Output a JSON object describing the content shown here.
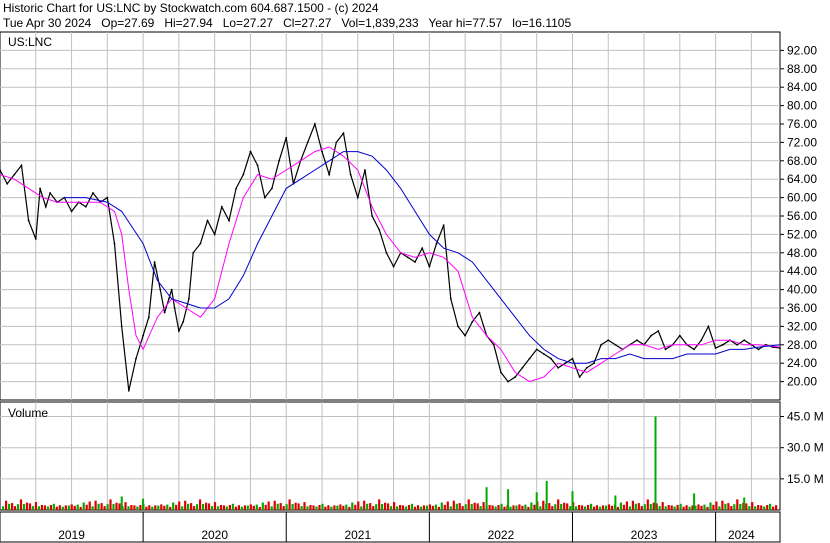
{
  "header": {
    "line1": "Historic Chart for US:LNC by Stockwatch.com 604.687.1500 - (c) 2024",
    "line2": "Tue Apr 30 2024   Op=27.69   Hi=27.94   Lo=27.27   Cl=27.27   Vol=1,839,233   Year hi=77.57   lo=16.1105"
  },
  "chart_data": [
    {
      "type": "line",
      "title": "US:LNC",
      "ylim": [
        16,
        96
      ],
      "yticks": [
        20,
        24,
        28,
        32,
        36,
        40,
        44,
        48,
        52,
        56,
        60,
        64,
        68,
        72,
        76,
        80,
        84,
        88,
        92
      ],
      "ytick_labels": [
        "20.00",
        "24.00",
        "28.00",
        "32.00",
        "36.00",
        "40.00",
        "44.00",
        "48.00",
        "52.00",
        "56.00",
        "60.00",
        "64.00",
        "68.00",
        "72.00",
        "76.00",
        "80.00",
        "84.00",
        "88.00",
        "92.00"
      ],
      "xlim": [
        2019.0,
        2024.45
      ],
      "xticks": [
        2019.5,
        2020.5,
        2021.5,
        2022.5,
        2023.5,
        2024.18
      ],
      "xtick_labels": [
        "2019",
        "2020",
        "2021",
        "2022",
        "2023",
        "2024"
      ],
      "grid": true,
      "colors": {
        "price": "#000000",
        "ma_short": "#ff00ff",
        "ma_long": "#0000cc",
        "grid": "#c0c0c0"
      },
      "series": [
        {
          "role": "price",
          "x": [
            2019.0,
            2019.05,
            2019.1,
            2019.15,
            2019.2,
            2019.25,
            2019.28,
            2019.32,
            2019.35,
            2019.4,
            2019.45,
            2019.5,
            2019.55,
            2019.6,
            2019.65,
            2019.7,
            2019.75,
            2019.8,
            2019.85,
            2019.9,
            2019.95,
            2020.0,
            2020.04,
            2020.08,
            2020.12,
            2020.15,
            2020.18,
            2020.2,
            2020.22,
            2020.25,
            2020.28,
            2020.32,
            2020.35,
            2020.4,
            2020.45,
            2020.5,
            2020.55,
            2020.6,
            2020.65,
            2020.7,
            2020.75,
            2020.8,
            2020.85,
            2020.9,
            2020.95,
            2021.0,
            2021.05,
            2021.1,
            2021.15,
            2021.2,
            2021.25,
            2021.3,
            2021.35,
            2021.4,
            2021.45,
            2021.5,
            2021.55,
            2021.6,
            2021.65,
            2021.7,
            2021.75,
            2021.8,
            2021.85,
            2021.9,
            2021.95,
            2022.0,
            2022.05,
            2022.1,
            2022.15,
            2022.2,
            2022.25,
            2022.3,
            2022.35,
            2022.4,
            2022.45,
            2022.5,
            2022.55,
            2022.6,
            2022.65,
            2022.7,
            2022.75,
            2022.8,
            2022.85,
            2022.9,
            2022.95,
            2023.0,
            2023.05,
            2023.1,
            2023.15,
            2023.2,
            2023.25,
            2023.3,
            2023.35,
            2023.4,
            2023.45,
            2023.5,
            2023.55,
            2023.6,
            2023.65,
            2023.7,
            2023.75,
            2023.8,
            2023.85,
            2023.9,
            2023.95,
            2024.0,
            2024.05,
            2024.1,
            2024.15,
            2024.2,
            2024.25,
            2024.3,
            2024.35,
            2024.4,
            2024.45
          ],
          "values": [
            66,
            63,
            65,
            67,
            55,
            51,
            62,
            58,
            61,
            59,
            60,
            57,
            59,
            58,
            61,
            59,
            60,
            50,
            32,
            18,
            25,
            30,
            34,
            46,
            40,
            35,
            38,
            40,
            36,
            31,
            33,
            38,
            48,
            50,
            55,
            52,
            58,
            55,
            62,
            65,
            70,
            67,
            60,
            62,
            68,
            73,
            63,
            68,
            72,
            76,
            70,
            65,
            72,
            74,
            65,
            60,
            66,
            56,
            53,
            48,
            45,
            48,
            47,
            46,
            49,
            45,
            50,
            54,
            38,
            32,
            30,
            33,
            35,
            30,
            28,
            22,
            20,
            21,
            23,
            25,
            27,
            26,
            25,
            23,
            24,
            25,
            21,
            23,
            24,
            28,
            29,
            28,
            27,
            28,
            29,
            28,
            30,
            31,
            27,
            28,
            30,
            28,
            27,
            29,
            32,
            27.3,
            28,
            29,
            28,
            29,
            28,
            27,
            28,
            27.5,
            27.3
          ]
        },
        {
          "role": "ma_short",
          "name": "",
          "x": [
            2019.0,
            2019.1,
            2019.2,
            2019.3,
            2019.4,
            2019.5,
            2019.6,
            2019.7,
            2019.8,
            2019.85,
            2019.9,
            2019.95,
            2020.0,
            2020.1,
            2020.2,
            2020.3,
            2020.4,
            2020.5,
            2020.6,
            2020.7,
            2020.8,
            2020.9,
            2021.0,
            2021.1,
            2021.2,
            2021.3,
            2021.4,
            2021.5,
            2021.6,
            2021.7,
            2021.8,
            2021.9,
            2022.0,
            2022.1,
            2022.2,
            2022.3,
            2022.4,
            2022.5,
            2022.6,
            2022.7,
            2022.8,
            2022.9,
            2023.0,
            2023.1,
            2023.2,
            2023.3,
            2023.4,
            2023.5,
            2023.6,
            2023.7,
            2023.8,
            2023.9,
            2024.0,
            2024.1,
            2024.2,
            2024.3,
            2024.45
          ],
          "values": [
            65,
            64,
            62,
            60,
            59,
            59,
            59,
            59,
            57,
            52,
            40,
            30,
            27,
            34,
            38,
            36,
            34,
            38,
            50,
            60,
            65,
            64,
            66,
            68,
            70,
            71,
            69,
            66,
            58,
            52,
            48,
            47,
            48,
            47,
            44,
            34,
            30,
            27,
            22,
            20,
            21,
            24,
            23,
            22,
            24,
            26,
            28,
            28,
            27,
            28,
            28,
            28,
            29,
            29,
            28,
            28,
            27.5
          ]
        },
        {
          "role": "ma_long",
          "name": "",
          "x": [
            2019.45,
            2019.6,
            2019.75,
            2019.85,
            2020.0,
            2020.1,
            2020.2,
            2020.3,
            2020.4,
            2020.5,
            2020.6,
            2020.7,
            2020.8,
            2020.9,
            2021.0,
            2021.1,
            2021.2,
            2021.3,
            2021.4,
            2021.5,
            2021.6,
            2021.7,
            2021.8,
            2021.9,
            2022.0,
            2022.1,
            2022.2,
            2022.3,
            2022.4,
            2022.5,
            2022.6,
            2022.7,
            2022.8,
            2022.9,
            2023.0,
            2023.1,
            2023.2,
            2023.3,
            2023.4,
            2023.5,
            2023.6,
            2023.7,
            2023.8,
            2023.9,
            2024.0,
            2024.1,
            2024.2,
            2024.3,
            2024.45
          ],
          "values": [
            60,
            60,
            59,
            57,
            50,
            42,
            38,
            37,
            36,
            36,
            38,
            43,
            50,
            56,
            62,
            64,
            66,
            68,
            70,
            70,
            69,
            66,
            62,
            57,
            52,
            49,
            48,
            46,
            42,
            38,
            34,
            30,
            27,
            25,
            24,
            24,
            25,
            25,
            26,
            25,
            25,
            25,
            26,
            26,
            26,
            27,
            27,
            27.5,
            28
          ]
        }
      ]
    },
    {
      "type": "bar",
      "title": "Volume",
      "ylim": [
        0,
        52
      ],
      "yticks": [
        15,
        30,
        45
      ],
      "ytick_labels": [
        "15.0 M",
        "30.0 M",
        "45.0 M"
      ],
      "xlim": [
        2019.0,
        2024.45
      ],
      "grid": true,
      "colors": {
        "up": "#00aa00",
        "down": "#dd0000",
        "spike": "#00aa00"
      },
      "baseline_values": [
        1.8,
        2.4,
        1.5,
        3.2,
        2.1,
        2.8,
        1.6,
        4.5,
        2.2,
        3.6,
        1.9,
        2.7,
        5.1,
        2.3,
        3.0,
        1.7,
        2.5,
        3.8,
        2.0,
        2.9,
        1.6,
        3.3,
        2.4,
        4.1,
        1.8,
        2.6,
        3.5,
        2.2,
        1.9,
        3.0
      ],
      "spikes": [
        {
          "x": 2019.85,
          "value": 6.5
        },
        {
          "x": 2020.0,
          "value": 5.5
        },
        {
          "x": 2022.4,
          "value": 11.0
        },
        {
          "x": 2022.55,
          "value": 10.0
        },
        {
          "x": 2022.75,
          "value": 8.5
        },
        {
          "x": 2022.82,
          "value": 14.0
        },
        {
          "x": 2023.0,
          "value": 9.0
        },
        {
          "x": 2023.3,
          "value": 7.0
        },
        {
          "x": 2023.58,
          "value": 45.0
        },
        {
          "x": 2023.85,
          "value": 8.0
        },
        {
          "x": 2024.2,
          "value": 6.0
        }
      ]
    }
  ]
}
